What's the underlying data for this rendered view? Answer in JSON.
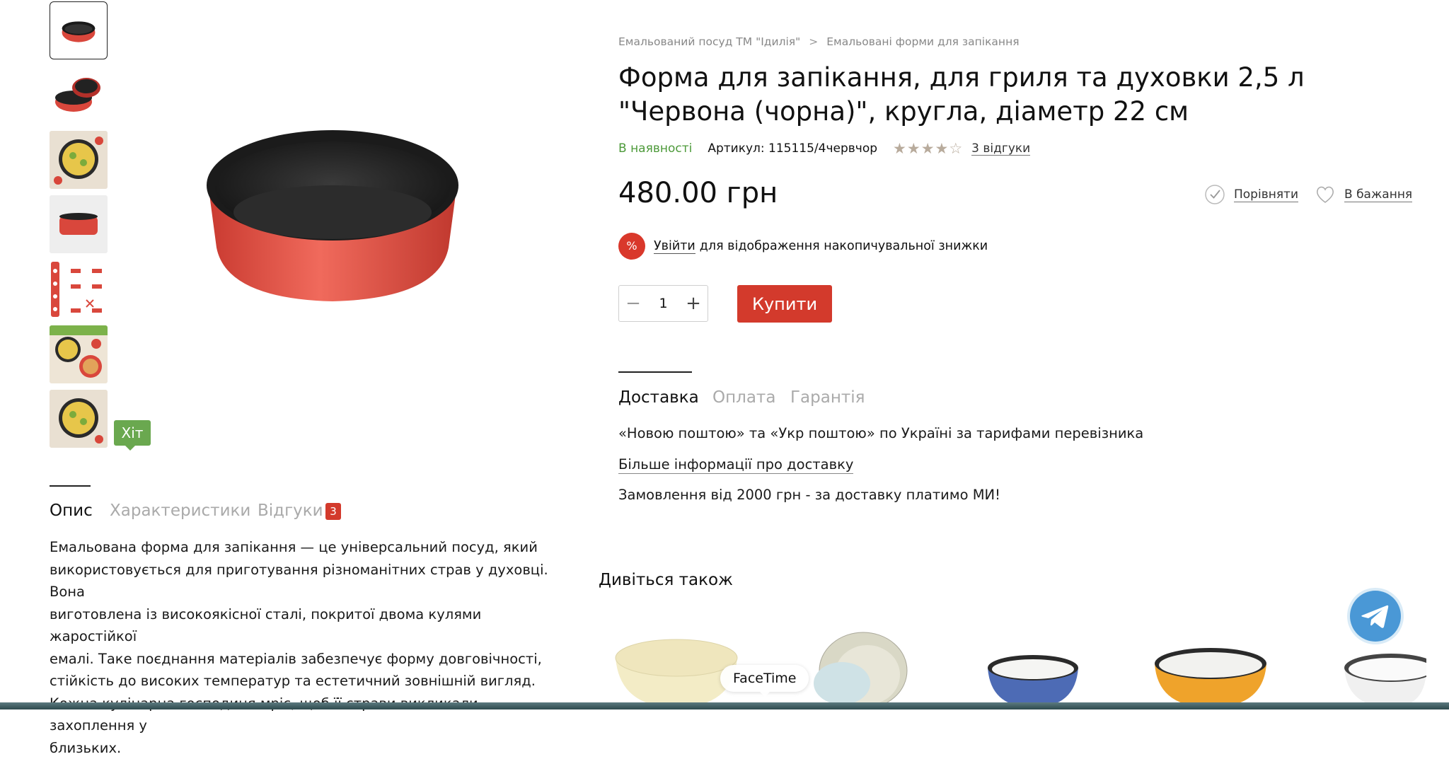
{
  "breadcrumb": {
    "items": [
      "Емальований посуд ТМ \"Ідилія\"",
      "Емальовані форми для запікання"
    ],
    "separator": ">"
  },
  "product": {
    "title": "Форма для запікання, для гриля та духовки 2,5 л \"Червона (чорна)\", кругла, діаметр 22 см",
    "availability": "В наявності",
    "sku": "Артикул: 115115/4червчор",
    "rating": 4,
    "rating_max": 5,
    "reviews_link": "3 відгуки",
    "price": "480.00 грн",
    "badge": "Хіт"
  },
  "actions": {
    "compare": "Порівняти",
    "wishlist": "В бажання"
  },
  "discount": {
    "icon_text": "%",
    "login_label": "Увійти",
    "text": "для відображення накопичувальної знижки"
  },
  "purchase": {
    "quantity": "1",
    "minus": "−",
    "plus": "+",
    "buy_label": "Купити"
  },
  "info_tabs": {
    "tabs": [
      "Доставка",
      "Оплата",
      "Гарантія"
    ],
    "active": "Доставка",
    "delivery_line": "«Новою поштою» та «Укр поштою» по Україні за тарифами перевізника",
    "more_link": "Більше інформації про доставку",
    "free_shipping": "Замовлення від 2000 грн - за доставку платимо МИ!"
  },
  "desc_tabs": {
    "tabs": [
      "Опис",
      "Характеристики",
      "Відгуки"
    ],
    "active": "Опис",
    "review_count": "3",
    "text_lines": [
      "Емальована форма для запікання — це універсальний посуд, який",
      "використовується для приготування різноманітних страв у духовці. Вона",
      "виготовлена із високоякісної сталі, покритої двома кулями жаростійкої",
      "емалі. Таке поєднання матеріалів забезпечує форму довговічності,",
      "стійкість до високих температур та естетичний зовнішній вигляд.",
      "Кожна кулінарна господиня мріє, щоб її страви викликали захоплення у",
      "близьких."
    ]
  },
  "see_also": {
    "title": "Дивіться також"
  },
  "overlay": {
    "facetime_tooltip": "FaceTime"
  },
  "icons": {
    "compare": "check-circle-icon",
    "wishlist": "heart-icon",
    "telegram": "telegram-icon",
    "discount": "percent-badge-icon"
  },
  "colors": {
    "accent_red": "#d33a2c",
    "in_stock_green": "#4d9a3a",
    "hit_badge_green": "#6aa84f",
    "telegram_blue": "#4a98d6"
  }
}
